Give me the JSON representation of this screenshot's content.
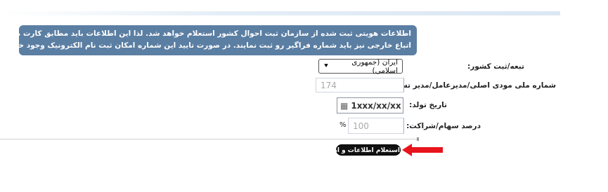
{
  "notice": {
    "line1": "اطلاعات هویتی ثبت شده از سازمان ثبت احوال کشور استعلام خواهد شد. لذا این اطلاعات باید مطابق کارت ملی شخص باشد.",
    "line2": "اتباع خارجی نیز باید شماره فراگیر رو ثبت نمایند. در صورت تایید این شماره امکان ثبت نام الکترونیک وجود خواهد داشت."
  },
  "form": {
    "nationality": {
      "label": "تبعه/ثبت کشور:",
      "value": "ایران (جمهوری اسلامی)"
    },
    "national_id": {
      "label": "شماره ملی مودی اصلی/مدیرعامل/مدیر تسویه:",
      "value": "174"
    },
    "birth_date": {
      "label": "تاریخ تولد:",
      "value": "1xxx/xx/xx"
    },
    "share_percent": {
      "label": "درصد سهام/شراکت:",
      "value": "100",
      "unit": "%"
    }
  },
  "submit": {
    "label": "استعلام اطلاعات و ادامه"
  },
  "colors": {
    "notice_bg": "#5b7ea3",
    "arrow": "#e8141b"
  }
}
